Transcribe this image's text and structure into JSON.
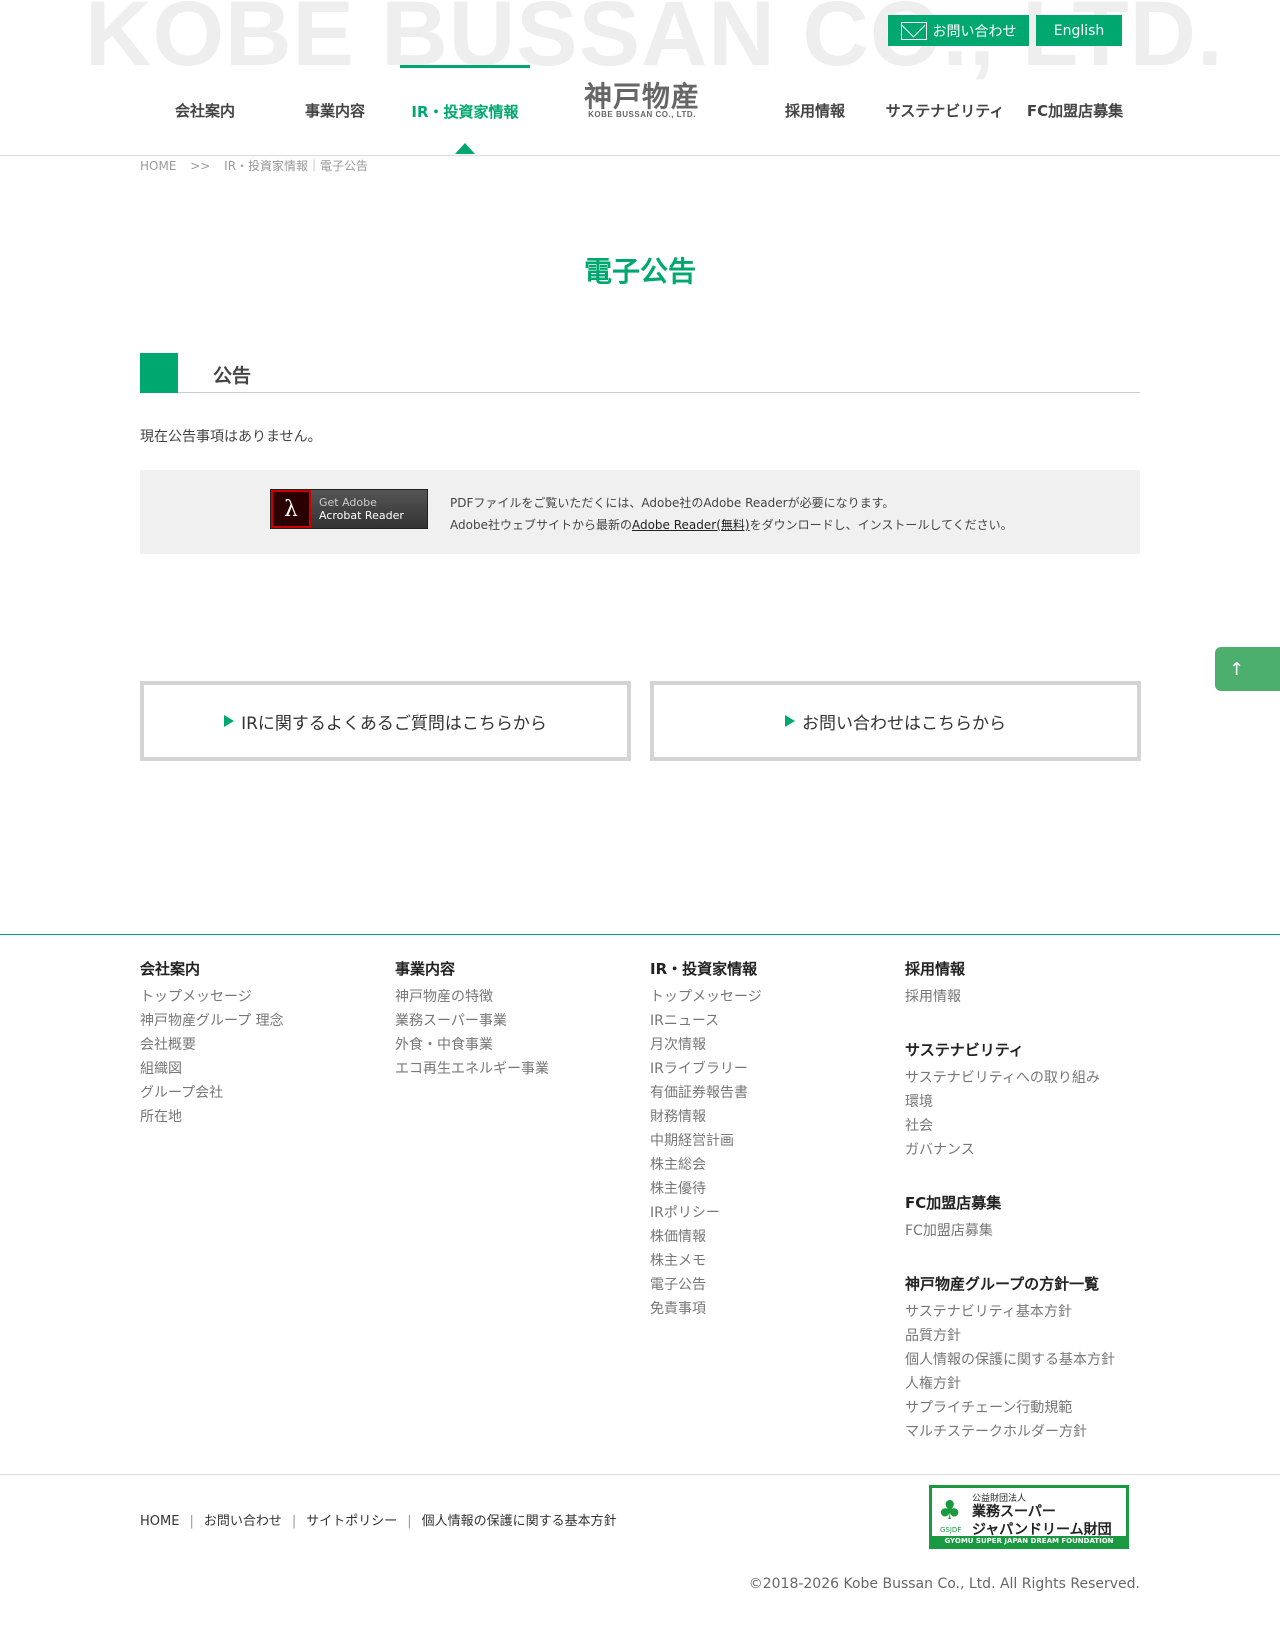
{
  "header": {
    "watermark": "KOBE BUSSAN CO., LTD.",
    "contact_label": "お問い合わせ",
    "english_label": "English",
    "logo_main": "神戸物産",
    "logo_sub": "KOBE BUSSAN CO., LTD.",
    "nav": {
      "company": "会社案内",
      "business": "事業内容",
      "ir": "IR・投資家情報",
      "recruit": "採用情報",
      "sustainability": "サステナビリティ",
      "fc": "FC加盟店募集"
    }
  },
  "breadcrumb": {
    "home": "HOME",
    "sep": ">>",
    "current": "IR・投資家情報｜電子公告"
  },
  "page_title": "電子公告",
  "section": {
    "title": "公告",
    "text": "現在公告事項はありません。"
  },
  "adobe": {
    "badge_line1": "Get Adobe",
    "badge_line2": "Acrobat Reader",
    "msg1": "PDFファイルをご覧いただくには、Adobe社のAdobe Readerが必要になります。",
    "msg2_pre": "Adobe社ウェブサイトから最新の",
    "msg2_link": "Adobe Reader(無料)",
    "msg2_post": "をダウンロードし、インストールしてください。"
  },
  "cta": {
    "faq": "IRに関するよくあるご質問はこちらから",
    "contact": "お問い合わせはこちらから"
  },
  "pagetop_icon": "arrow-up-icon",
  "footer": {
    "col1": {
      "title": "会社案内",
      "items": [
        "トップメッセージ",
        "神戸物産グループ 理念",
        "会社概要",
        "組織図",
        "グループ会社",
        "所在地"
      ]
    },
    "col2": {
      "title": "事業内容",
      "items": [
        "神戸物産の特徴",
        "業務スーパー事業",
        "外食・中食事業",
        "エコ再生エネルギー事業"
      ]
    },
    "col3": {
      "title": "IR・投資家情報",
      "items": [
        "トップメッセージ",
        "IRニュース",
        "月次情報",
        "IRライブラリー",
        "有価証券報告書",
        "財務情報",
        "中期経営計画",
        "株主総会",
        "株主優待",
        "IRポリシー",
        "株価情報",
        "株主メモ",
        "電子公告",
        "免責事項"
      ]
    },
    "col4a": {
      "title": "採用情報",
      "items": [
        "採用情報"
      ]
    },
    "col4b": {
      "title": "サステナビリティ",
      "items": [
        "サステナビリティへの取り組み",
        "環境",
        "社会",
        "ガバナンス"
      ]
    },
    "col4c": {
      "title": "FC加盟店募集",
      "items": [
        "FC加盟店募集"
      ]
    },
    "col4d": {
      "title": "神戸物産グループの方針一覧",
      "items": [
        "サステナビリティ基本方針",
        "品質方針",
        "個人情報の保護に関する基本方針",
        "人権方針",
        "サプライチェーン行動規範",
        "マルチステークホルダー方針"
      ]
    },
    "links": [
      "HOME",
      "お問い合わせ",
      "サイトポリシー",
      "個人情報の保護に関する基本方針"
    ],
    "link_sep": "|",
    "gsjdf": {
      "line1": "公益財団法人",
      "line2": "業務スーパー",
      "line3": "ジャパンドリーム財団",
      "abbr": "GSJDF",
      "line4": "GYOMU SUPER JAPAN DREAM FOUNDATION"
    },
    "copyright": "©2018-2026 Kobe Bussan Co., Ltd. All Rights Reserved."
  }
}
